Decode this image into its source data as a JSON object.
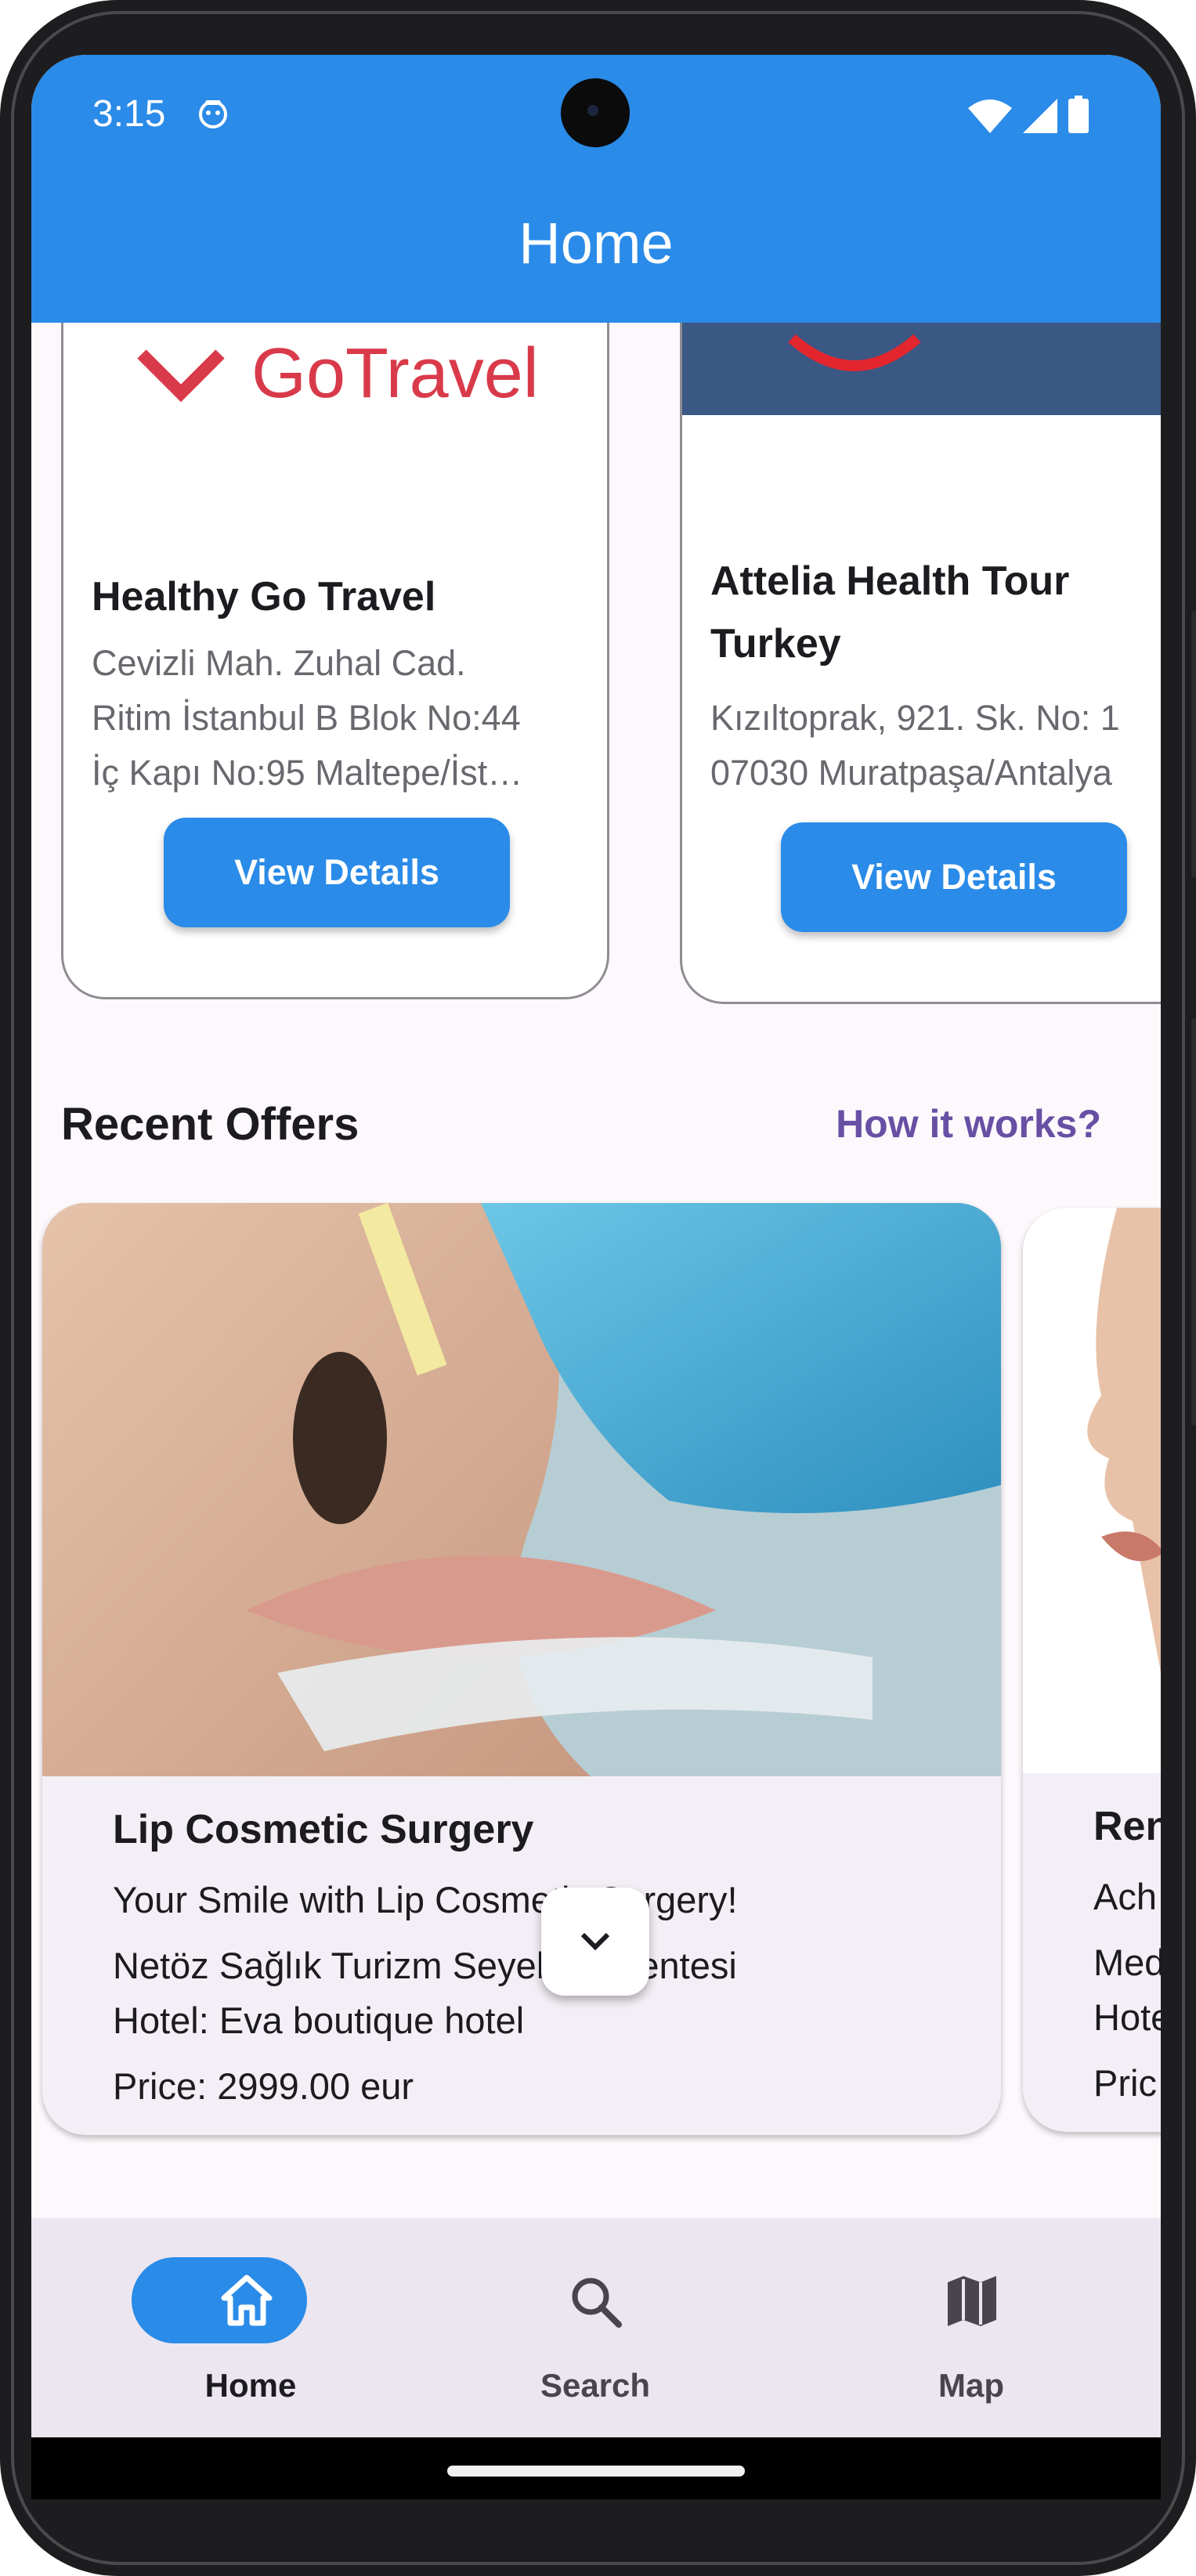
{
  "status_bar": {
    "time": "3:15"
  },
  "app_bar": {
    "title": "Home"
  },
  "agencies": [
    {
      "name": "Healthy Go Travel",
      "address_lines": [
        "Cevizli Mah. Zuhal Cad.",
        "Ritim İstanbul B Blok No:44",
        "İç Kapı No:95 Maltepe/İst…"
      ],
      "button_label": "View Details",
      "logo_text": "GoTravel"
    },
    {
      "name_lines": [
        "Attelia Health Tour",
        "Turkey"
      ],
      "address_lines": [
        "Kızıltoprak, 921. Sk. No: 1",
        "07030 Muratpaşa/Antalya"
      ],
      "button_label": "View Details"
    }
  ],
  "recent_offers": {
    "title": "Recent Offers",
    "link": "How it works?",
    "items": [
      {
        "title": "Lip Cosmetic Surgery",
        "subtitle": "Your Smile with Lip Cosmetic Surgery!",
        "agency": "Netöz Sağlık Turizm Seyehat Acentesi",
        "hotel": "Hotel: Eva boutique hotel",
        "price": "Price:  2999.00 eur"
      },
      {
        "title": "Ren",
        "subtitle": "Ach",
        "agency": "Med",
        "hotel": "Hote",
        "price": "Pric"
      }
    ]
  },
  "bottom_nav": {
    "items": [
      {
        "label": "Home",
        "icon": "home-icon",
        "active": true
      },
      {
        "label": "Search",
        "icon": "search-icon",
        "active": false
      },
      {
        "label": "Map",
        "icon": "map-icon",
        "active": false
      }
    ]
  },
  "colors": {
    "primary": "#2a8be8",
    "link": "#6750a4",
    "surface": "#fdf8fc",
    "nav_bg": "#ece6f0"
  }
}
